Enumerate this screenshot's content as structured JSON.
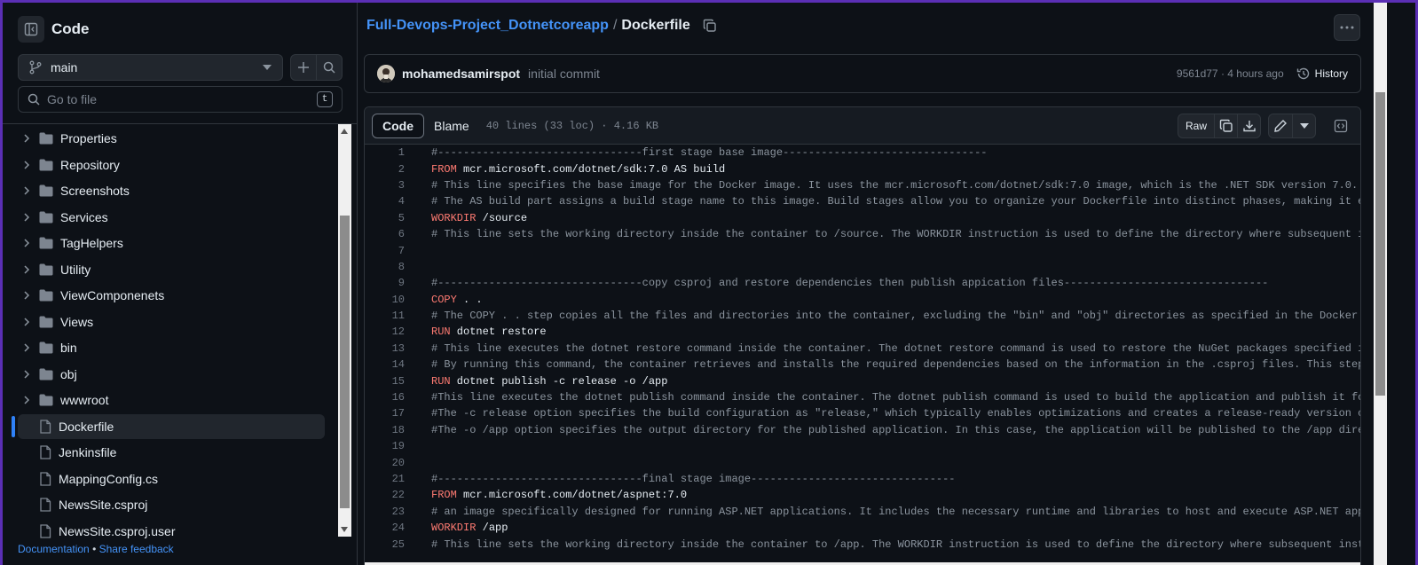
{
  "sidebar": {
    "title": "Code",
    "branch": "main",
    "goto_placeholder": "Go to file",
    "goto_shortcut": "t",
    "tree": [
      {
        "label": "Properties",
        "type": "folder"
      },
      {
        "label": "Repository",
        "type": "folder"
      },
      {
        "label": "Screenshots",
        "type": "folder"
      },
      {
        "label": "Services",
        "type": "folder"
      },
      {
        "label": "TagHelpers",
        "type": "folder"
      },
      {
        "label": "Utility",
        "type": "folder"
      },
      {
        "label": "ViewComponenets",
        "type": "folder"
      },
      {
        "label": "Views",
        "type": "folder"
      },
      {
        "label": "bin",
        "type": "folder"
      },
      {
        "label": "obj",
        "type": "folder"
      },
      {
        "label": "wwwroot",
        "type": "folder"
      },
      {
        "label": "Dockerfile",
        "type": "file",
        "selected": true
      },
      {
        "label": "Jenkinsfile",
        "type": "file"
      },
      {
        "label": "MappingConfig.cs",
        "type": "file"
      },
      {
        "label": "NewsSite.csproj",
        "type": "file"
      },
      {
        "label": "NewsSite.csproj.user",
        "type": "file"
      }
    ],
    "footer": {
      "documentation": "Documentation",
      "bullet": "•",
      "feedback": "Share feedback"
    }
  },
  "breadcrumb": {
    "repo": "Full-Devops-Project_Dotnetcoreapp",
    "separator": "/",
    "file": "Dockerfile"
  },
  "commit": {
    "author": "mohamedsamirspot",
    "message": "initial commit",
    "hash_time": "9561d77 · 4 hours ago",
    "history_label": "History"
  },
  "file_header": {
    "tab_code": "Code",
    "tab_blame": "Blame",
    "info": "40 lines (33 loc) · 4.16 KB",
    "raw_label": "Raw"
  },
  "code_lines": [
    {
      "n": "1",
      "kw": "",
      "text": "#--------------------------------first stage base image--------------------------------",
      "comment": true
    },
    {
      "n": "2",
      "kw": "FROM",
      "text": " mcr.microsoft.com/dotnet/sdk:7.0 AS build",
      "comment": false
    },
    {
      "n": "3",
      "kw": "",
      "text": "# This line specifies the base image for the Docker image. It uses the mcr.microsoft.com/dotnet/sdk:7.0 image, which is the .NET SDK version 7.0. This base im",
      "comment": true
    },
    {
      "n": "4",
      "kw": "",
      "text": "# The AS build part assigns a build stage name to this image. Build stages allow you to organize your Dockerfile into distinct phases, making it easier to man",
      "comment": true
    },
    {
      "n": "5",
      "kw": "WORKDIR",
      "text": " /source",
      "comment": false
    },
    {
      "n": "6",
      "kw": "",
      "text": "# This line sets the working directory inside the container to /source. The WORKDIR instruction is used to define the directory where subsequent instructions",
      "comment": true
    },
    {
      "n": "7",
      "kw": "",
      "text": "",
      "comment": false
    },
    {
      "n": "8",
      "kw": "",
      "text": "",
      "comment": false
    },
    {
      "n": "9",
      "kw": "",
      "text": "#--------------------------------copy csproj and restore dependencies then publish appication files--------------------------------",
      "comment": true
    },
    {
      "n": "10",
      "kw": "COPY",
      "text": " . .",
      "comment": false
    },
    {
      "n": "11",
      "kw": "",
      "text": "# The COPY . . step copies all the files and directories into the container, excluding the \"bin\" and \"obj\" directories as specified in the Docker ignore file.",
      "comment": true
    },
    {
      "n": "12",
      "kw": "RUN",
      "text": " dotnet restore",
      "comment": false
    },
    {
      "n": "13",
      "kw": "",
      "text": "# This line executes the dotnet restore command inside the container. The dotnet restore command is used to restore the NuGet packages specified in the .cspro",
      "comment": true
    },
    {
      "n": "14",
      "kw": "",
      "text": "# By running this command, the container retrieves and installs the required dependencies based on the information in the .csproj files. This step ensures tha",
      "comment": true
    },
    {
      "n": "15",
      "kw": "RUN",
      "text": " dotnet publish -c release -o /app",
      "comment": false
    },
    {
      "n": "16",
      "kw": "",
      "text": "#This line executes the dotnet publish command inside the container. The dotnet publish command is used to build the application and publish it for deployment",
      "comment": true
    },
    {
      "n": "17",
      "kw": "",
      "text": "#The -c release option specifies the build configuration as \"release,\" which typically enables optimizations and creates a release-ready version of the applic",
      "comment": true
    },
    {
      "n": "18",
      "kw": "",
      "text": "#The -o /app option specifies the output directory for the published application. In this case, the application will be published to the /app directory inside",
      "comment": true
    },
    {
      "n": "19",
      "kw": "",
      "text": "",
      "comment": false
    },
    {
      "n": "20",
      "kw": "",
      "text": "",
      "comment": false
    },
    {
      "n": "21",
      "kw": "",
      "text": "#--------------------------------final stage image--------------------------------",
      "comment": true
    },
    {
      "n": "22",
      "kw": "FROM",
      "text": " mcr.microsoft.com/dotnet/aspnet:7.0",
      "comment": false
    },
    {
      "n": "23",
      "kw": "",
      "text": "# an image specifically designed for running ASP.NET applications. It includes the necessary runtime and libraries to host and execute ASP.NET applications.",
      "comment": true
    },
    {
      "n": "24",
      "kw": "WORKDIR",
      "text": " /app",
      "comment": false
    },
    {
      "n": "25",
      "kw": "",
      "text": "# This line sets the working directory inside the container to /app. The WORKDIR instruction is used to define the directory where subsequent instructions wil",
      "comment": true
    }
  ],
  "colors": {
    "background": "#0d1117",
    "accent_link": "#4493f8",
    "keyword": "#ff7b72",
    "comment": "#8b949e",
    "border": "#30363d"
  }
}
